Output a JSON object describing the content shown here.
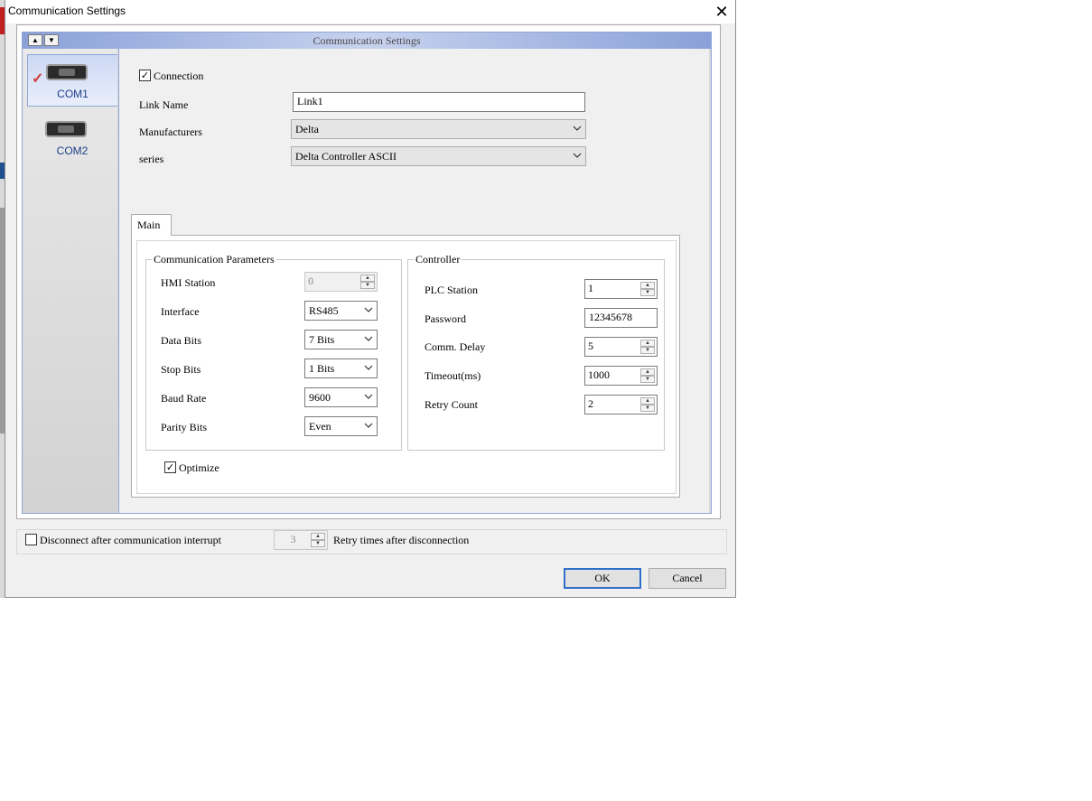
{
  "window": {
    "title": "Communication Settings",
    "close_glyph": "✕"
  },
  "panel": {
    "title": "Communication Settings"
  },
  "ports": [
    {
      "label": "COM1",
      "selected": true,
      "icon": "serial-port-icon"
    },
    {
      "label": "COM2",
      "selected": false,
      "icon": "serial-port-icon"
    }
  ],
  "connection": {
    "label": "Connection",
    "checked": "✓"
  },
  "link_name": {
    "label": "Link Name",
    "value": "Link1"
  },
  "manufacturers": {
    "label": "Manufacturers",
    "value": "Delta"
  },
  "series": {
    "label": "series",
    "value": "Delta Controller ASCII"
  },
  "tabs": [
    {
      "label": "Main"
    }
  ],
  "comm_params": {
    "title": "Communication Parameters",
    "hmi_station": {
      "label": "HMI Station",
      "value": "0"
    },
    "interface": {
      "label": "Interface",
      "value": "RS485"
    },
    "data_bits": {
      "label": "Data Bits",
      "value": "7 Bits"
    },
    "stop_bits": {
      "label": "Stop Bits",
      "value": "1 Bits"
    },
    "baud_rate": {
      "label": "Baud Rate",
      "value": "9600"
    },
    "parity_bits": {
      "label": "Parity Bits",
      "value": "Even"
    }
  },
  "controller": {
    "title": "Controller",
    "plc_station": {
      "label": "PLC Station",
      "value": "1"
    },
    "password": {
      "label": "Password",
      "value": "12345678"
    },
    "comm_delay": {
      "label": "Comm. Delay",
      "value": "5"
    },
    "timeout": {
      "label": "Timeout(ms)",
      "value": "1000"
    },
    "retry_count": {
      "label": "Retry Count",
      "value": "2"
    }
  },
  "optimize": {
    "label": "Optimize",
    "checked": "✓"
  },
  "disconnect": {
    "label": "Disconnect after communication interrupt",
    "checked": ""
  },
  "retry_after": {
    "value": "3",
    "label": "Retry times after disconnection"
  },
  "buttons": {
    "ok": "OK",
    "cancel": "Cancel"
  }
}
